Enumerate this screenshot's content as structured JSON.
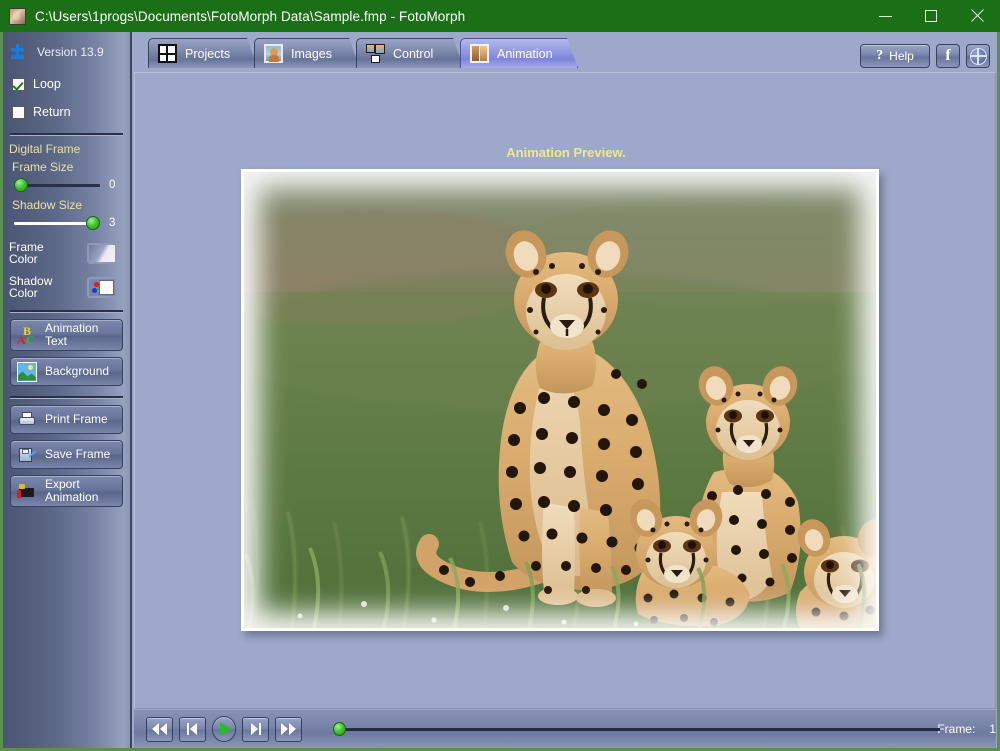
{
  "window": {
    "title": "C:\\Users\\1progs\\Documents\\FotoMorph Data\\Sample.fmp - FotoMorph",
    "app_icon": "photo-icon",
    "minimize_label": "–",
    "maximize_label": "□",
    "close_label": "✕",
    "titlebar_color": "#1b7017"
  },
  "sidebar": {
    "version": "Version 13.9",
    "logo_icon": "fotomorph-logo-icon",
    "checkboxes": [
      {
        "label": "Loop",
        "checked": true
      },
      {
        "label": "Return",
        "checked": false
      }
    ],
    "group_title": "Digital Frame",
    "sliders": [
      {
        "label": "Frame Size",
        "value": "0",
        "thumb_pct": 0,
        "track": "dark"
      },
      {
        "label": "Shadow Size",
        "value": "3",
        "thumb_pct": 86,
        "track": "light"
      }
    ],
    "colors": [
      {
        "label": "Frame\nColor",
        "swatch": "frame-gradient-swatch"
      },
      {
        "label": "Shadow\nColor",
        "swatch": "rgb-white-swatch"
      }
    ],
    "buttons": [
      {
        "label": "Animation\nText",
        "icon": "abc-letters-icon"
      },
      {
        "label": "Background",
        "icon": "landscape-picture-icon"
      },
      {
        "label": "Print Frame",
        "icon": "printer-icon"
      },
      {
        "label": "Save Frame",
        "icon": "floppy-disk-icon"
      },
      {
        "label": "Export\nAnimation",
        "icon": "film-camera-icon"
      }
    ]
  },
  "tabs": [
    {
      "label": "Projects",
      "icon": "grid-icon",
      "active": false
    },
    {
      "label": "Images",
      "icon": "portrait-icon",
      "active": false
    },
    {
      "label": "Control",
      "icon": "control-panels-icon",
      "active": false
    },
    {
      "label": "Animation",
      "icon": "morph-frames-icon",
      "active": true
    }
  ],
  "topright": {
    "help_label": "Help",
    "help_icon": "question-mark-icon",
    "facebook_label": "f",
    "facebook_icon": "facebook-icon",
    "web_icon": "globe-icon"
  },
  "preview": {
    "title": "Animation Preview.",
    "title_color": "#eee88f",
    "image_alt": "cheetah-family-photo"
  },
  "transport": {
    "buttons": [
      {
        "name": "rewind-all-button",
        "icon": "skip-backward-icon"
      },
      {
        "name": "previous-frame-button",
        "icon": "step-backward-icon"
      },
      {
        "name": "play-button",
        "icon": "play-icon"
      },
      {
        "name": "next-frame-button",
        "icon": "step-forward-icon"
      },
      {
        "name": "forward-all-button",
        "icon": "skip-forward-icon"
      }
    ],
    "frame_label": "Frame:",
    "frame_value": "1",
    "timeline_position_pct": 0
  },
  "theme": {
    "canvas_bg": "#9da8ca",
    "sidebar_dark": "#4a5673",
    "sidebar_light": "#96a1bf",
    "accent_green": "#2cb82c",
    "border_green": "#5c8f52"
  }
}
